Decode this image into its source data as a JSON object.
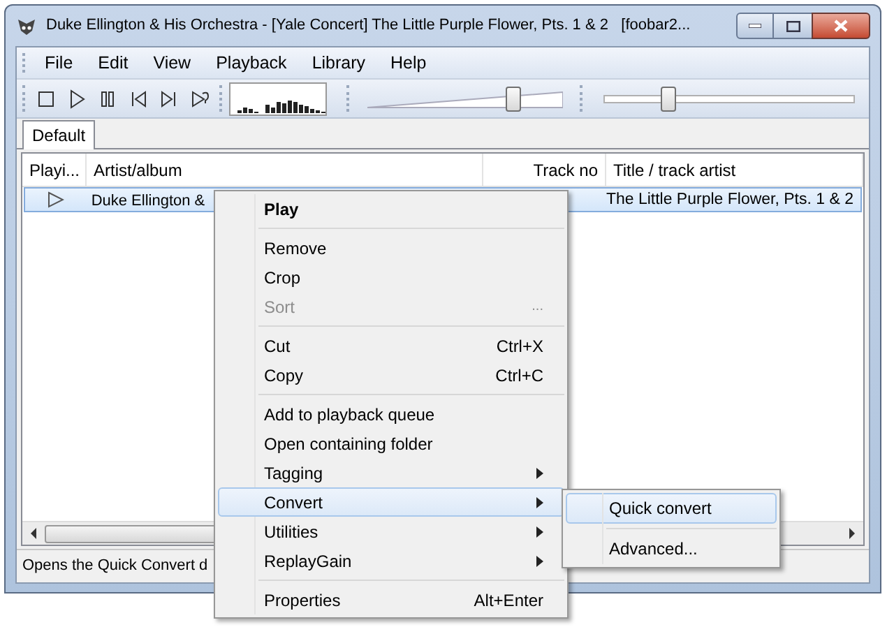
{
  "window": {
    "title": "Duke Ellington & His Orchestra - [Yale Concert] The Little Purple Flower, Pts. 1 & 2   [foobar2..."
  },
  "menu_bar": [
    "File",
    "Edit",
    "View",
    "Playback",
    "Library",
    "Help"
  ],
  "toolbar": {
    "buttons": [
      {
        "kind": "stop"
      },
      {
        "kind": "play"
      },
      {
        "kind": "pause"
      },
      {
        "kind": "previous"
      },
      {
        "kind": "next"
      },
      {
        "kind": "random"
      }
    ],
    "volume": {
      "level": 0.77
    },
    "seek": {
      "level": 0.24
    }
  },
  "tabs": [
    {
      "label": "Default",
      "selected": true
    }
  ],
  "table": {
    "columns": [
      {
        "label": "Playi..."
      },
      {
        "label": "Artist/album"
      },
      {
        "label": "Track no"
      },
      {
        "label": "Title / track artist"
      }
    ],
    "rows": [
      {
        "playing": true,
        "selected": true,
        "artist": "Duke Ellington &",
        "title": "The Little Purple Flower, Pts. 1 & 2"
      }
    ]
  },
  "context_menu": [
    {
      "kind": "item",
      "label": "Play",
      "default": true,
      "disabled": false,
      "submenu": false,
      "selected": false
    },
    {
      "kind": "separator"
    },
    {
      "kind": "item",
      "label": "Remove",
      "default": false,
      "disabled": false,
      "submenu": false,
      "selected": false
    },
    {
      "kind": "item",
      "label": "Crop",
      "default": false,
      "disabled": false,
      "submenu": false,
      "selected": false
    },
    {
      "kind": "item",
      "label": "Sort",
      "shortcut": "...",
      "default": false,
      "disabled": true,
      "submenu": false,
      "selected": false
    },
    {
      "kind": "separator"
    },
    {
      "kind": "item",
      "label": "Cut",
      "shortcut": "Ctrl+X",
      "default": false,
      "disabled": false,
      "submenu": false,
      "selected": false
    },
    {
      "kind": "item",
      "label": "Copy",
      "shortcut": "Ctrl+C",
      "default": false,
      "disabled": false,
      "submenu": false,
      "selected": false
    },
    {
      "kind": "separator"
    },
    {
      "kind": "item",
      "label": "Add to playback queue",
      "default": false,
      "disabled": false,
      "submenu": false,
      "selected": false
    },
    {
      "kind": "item",
      "label": "Open containing folder",
      "default": false,
      "disabled": false,
      "submenu": false,
      "selected": false
    },
    {
      "kind": "item",
      "label": "Tagging",
      "default": false,
      "disabled": false,
      "submenu": true,
      "selected": false
    },
    {
      "kind": "item",
      "label": "Convert",
      "default": false,
      "disabled": false,
      "submenu": true,
      "selected": true
    },
    {
      "kind": "item",
      "label": "Utilities",
      "default": false,
      "disabled": false,
      "submenu": true,
      "selected": false
    },
    {
      "kind": "item",
      "label": "ReplayGain",
      "default": false,
      "disabled": false,
      "submenu": true,
      "selected": false
    },
    {
      "kind": "separator"
    },
    {
      "kind": "item",
      "label": "Properties",
      "shortcut": "Alt+Enter",
      "default": false,
      "disabled": false,
      "submenu": false,
      "selected": false
    }
  ],
  "submenu": [
    {
      "kind": "item",
      "label": "Quick convert",
      "selected": true
    },
    {
      "kind": "separator"
    },
    {
      "kind": "item",
      "label": "Advanced...",
      "selected": false
    }
  ],
  "status_bar": "Opens the Quick Convert d"
}
